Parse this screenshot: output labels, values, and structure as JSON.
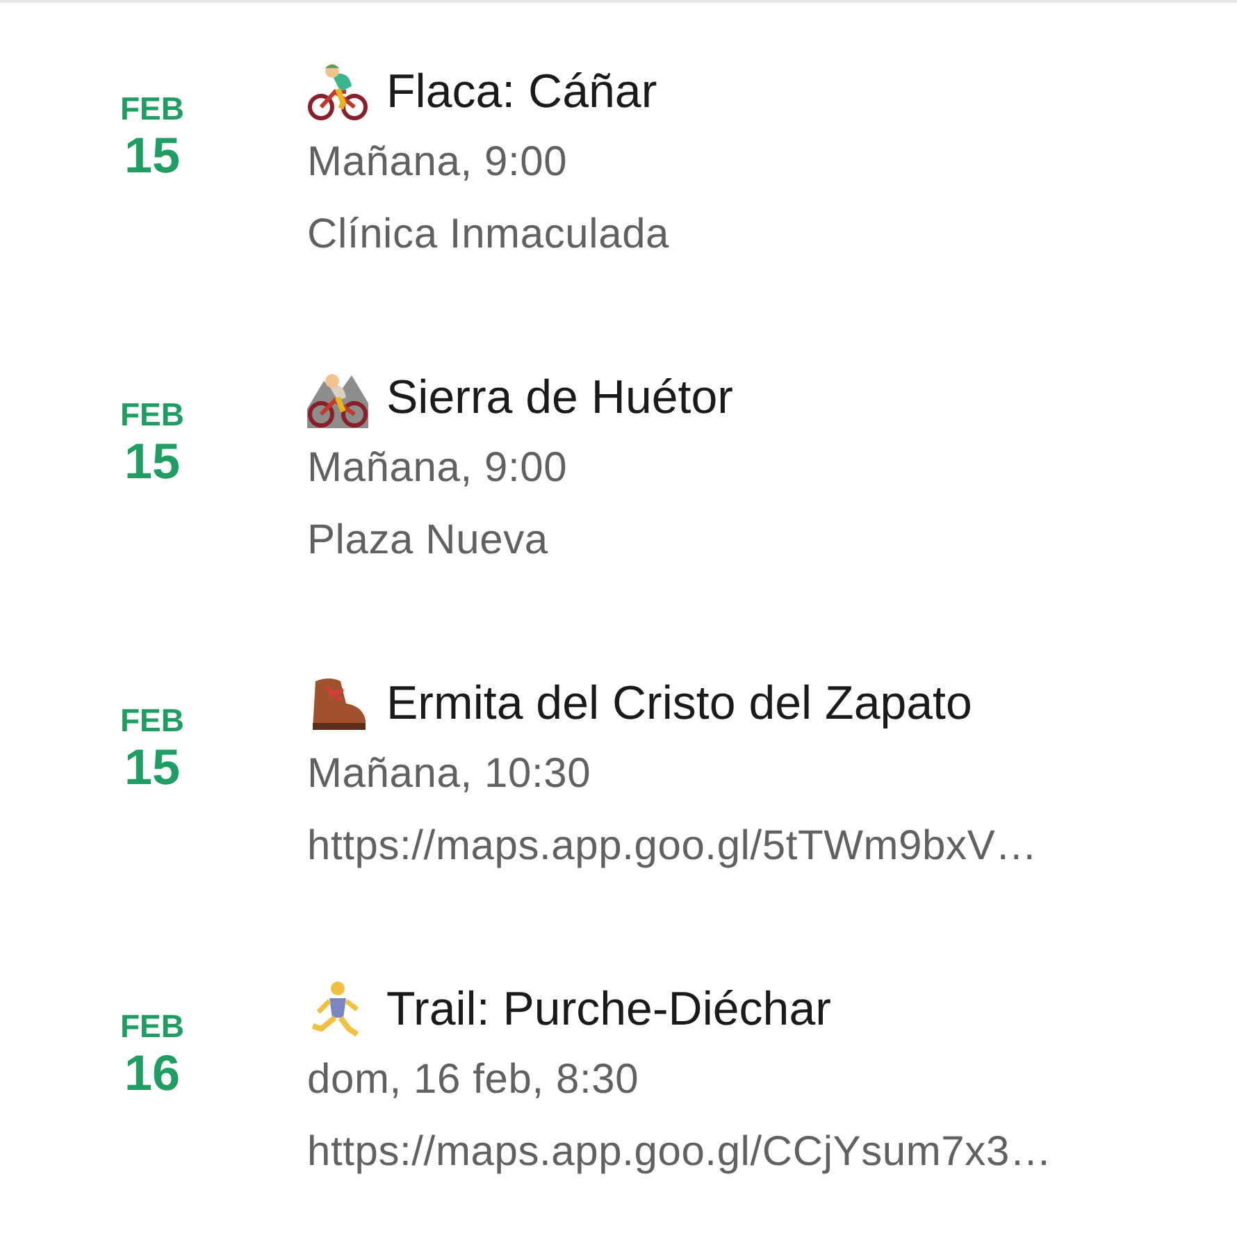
{
  "events": [
    {
      "month": "FEB",
      "day": "15",
      "kind": "cyclist",
      "title": "Flaca: Cáñar",
      "when": "Mañana, 9:00",
      "where": "Clínica Inmaculada"
    },
    {
      "month": "FEB",
      "day": "15",
      "kind": "mountain-biker",
      "title": "Sierra de Huétor",
      "when": "Mañana, 9:00",
      "where": "Plaza Nueva"
    },
    {
      "month": "FEB",
      "day": "15",
      "kind": "boot",
      "title": "Ermita del Cristo del Zapato",
      "when": "Mañana, 10:30",
      "where": "https://maps.app.goo.gl/5tTWm9bxV…"
    },
    {
      "month": "FEB",
      "day": "16",
      "kind": "runner",
      "title": "Trail: Purche-Diéchar",
      "when": "dom, 16 feb, 8:30",
      "where": "https://maps.app.goo.gl/CCjYsum7x3…"
    }
  ]
}
